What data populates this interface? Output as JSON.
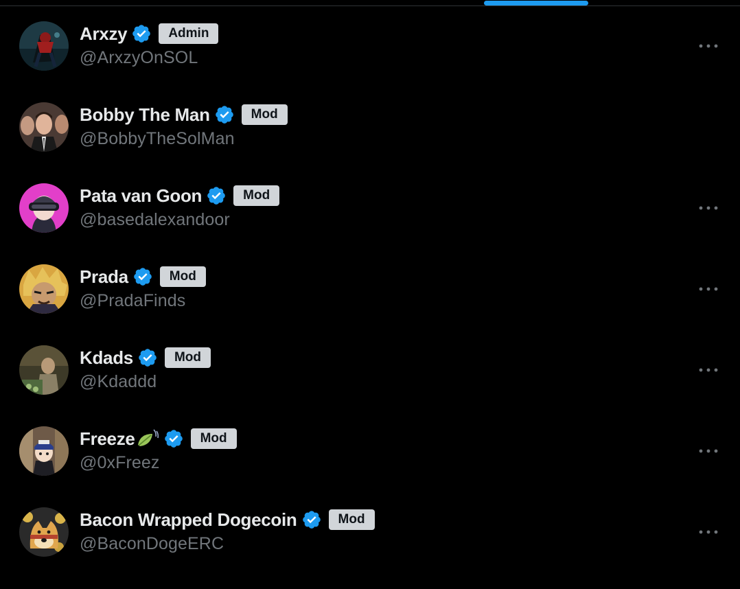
{
  "accent_color": "#1d9bf0",
  "members": [
    {
      "name": "Arxzy",
      "handle": "@ArxzyOnSOL",
      "role": "Admin",
      "verified": true,
      "avatar": "spiderman-avatar",
      "more_icon": true
    },
    {
      "name": "Bobby The Man",
      "handle": "@BobbyTheSolMan",
      "role": "Mod",
      "verified": true,
      "avatar": "suit-man-avatar",
      "more_icon": false
    },
    {
      "name": "Pata van Goon",
      "handle": "@basedalexandoor",
      "role": "Mod",
      "verified": true,
      "avatar": "vr-headset-avatar",
      "more_icon": true
    },
    {
      "name": "Prada",
      "handle": "@PradaFinds",
      "role": "Mod",
      "verified": true,
      "avatar": "anime-character-avatar",
      "more_icon": true
    },
    {
      "name": "Kdads",
      "handle": "@Kdaddd",
      "role": "Mod",
      "verified": true,
      "avatar": "photo-avatar",
      "more_icon": true
    },
    {
      "name": "Freeze",
      "handle": "@0xFreez",
      "role": "Mod",
      "verified": true,
      "avatar": "cartoon-cap-avatar",
      "emoji": "leaf-fluttering-in-wind",
      "more_icon": true
    },
    {
      "name": "Bacon Wrapped Dogecoin",
      "handle": "@BaconDogeERC",
      "role": "Mod",
      "verified": true,
      "avatar": "doge-avatar",
      "more_icon": true
    }
  ]
}
